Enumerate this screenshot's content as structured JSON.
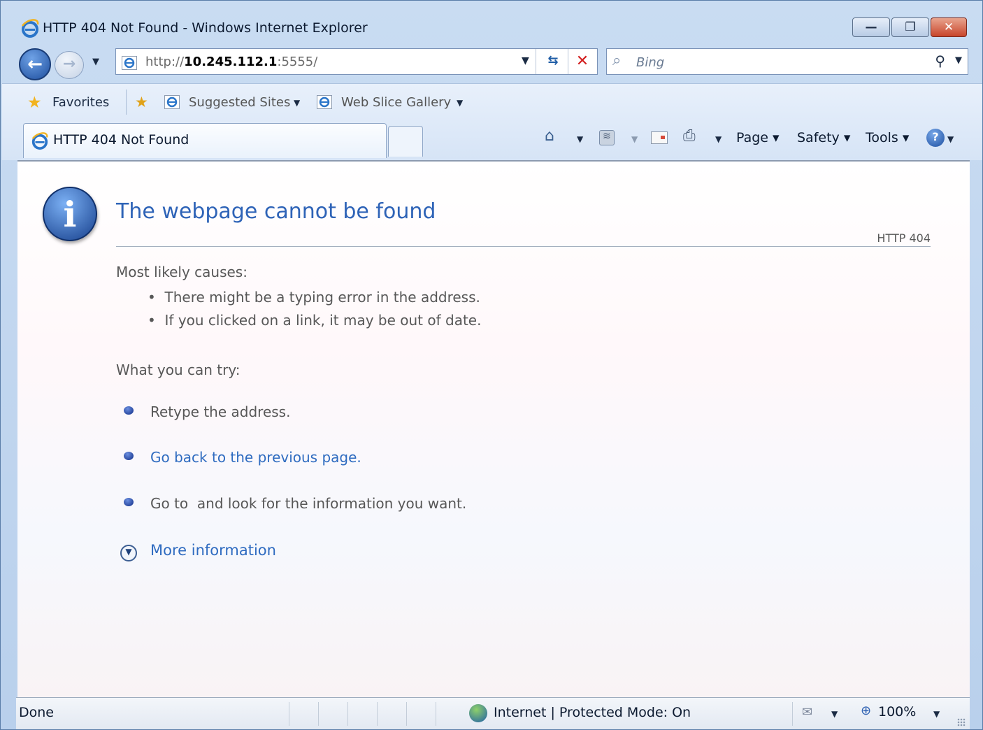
{
  "window": {
    "title": "HTTP 404 Not Found - Windows Internet Explorer",
    "minimize_glyph": "—",
    "restore_glyph": "❐",
    "close_glyph": "✕"
  },
  "nav": {
    "back_glyph": "←",
    "forward_glyph": "→",
    "history_drop": "▼"
  },
  "address": {
    "prefix": "http://",
    "host": "10.245.112.1",
    "suffix": ":5555/",
    "drop": "▼",
    "refresh_glyph": "⇆",
    "stop_glyph": "✕"
  },
  "search": {
    "placeholder": "Bing",
    "go_glyph": "⚲",
    "drop": "▼"
  },
  "favorites_bar": {
    "favorites_label": "Favorites",
    "suggested_sites_label": "Suggested Sites",
    "web_slice_gallery_label": "Web Slice Gallery",
    "drop": "▼"
  },
  "tabs": [
    {
      "title": "HTTP 404 Not Found"
    }
  ],
  "command_bar": {
    "drop": "▼",
    "page_label": "Page ▾",
    "safety_label": "Safety ▾",
    "tools_label": "Tools ▾",
    "help_glyph": "?"
  },
  "content": {
    "title": "The webpage cannot be found",
    "http_code": "HTTP 404",
    "causes_heading": "Most likely causes:",
    "causes": [
      "There might be a typing error in the address.",
      "If you clicked on a link, it may be out of date."
    ],
    "try_heading": "What you can try:",
    "try_items": [
      "Retype the address.",
      "Go back to the previous page.",
      "Go to  and look for the information you want."
    ],
    "more_info": "More information",
    "bullet": "•"
  },
  "status": {
    "text": "Done",
    "zone": "Internet | Protected Mode: On",
    "zoom": "100%",
    "drop": "▼"
  },
  "colors": {
    "accent_link": "#2e6bc0",
    "title_blue": "#2e63b7",
    "body_text": "#575757",
    "close_red": "#c8452b"
  }
}
